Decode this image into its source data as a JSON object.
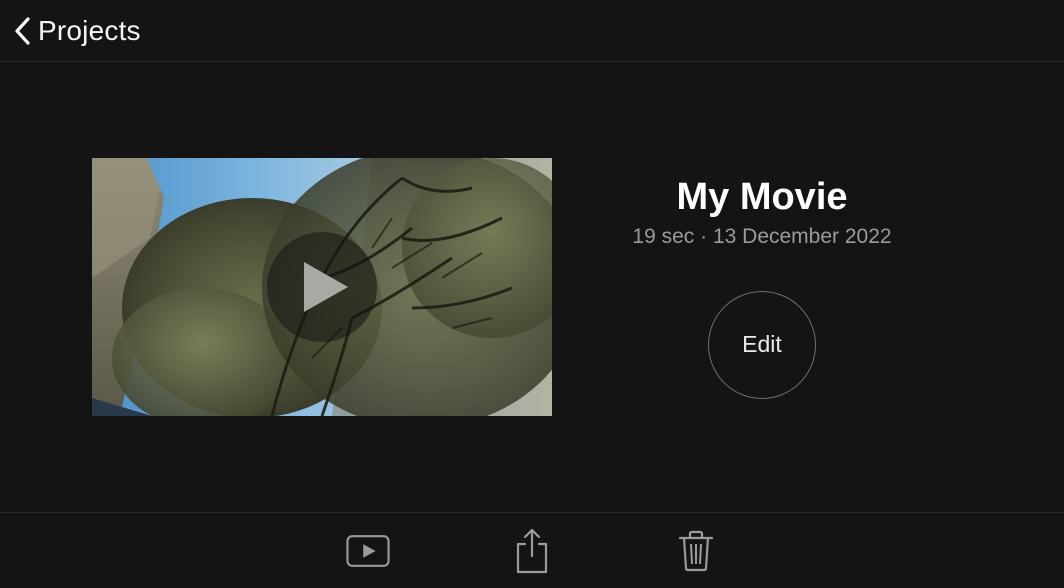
{
  "header": {
    "back_label": "Projects"
  },
  "project": {
    "title": "My Movie",
    "meta": "19 sec · 13 December 2022",
    "edit_label": "Edit"
  },
  "icons": {
    "back": "chevron-left-icon",
    "play": "play-icon",
    "video_play": "play-video-icon",
    "share": "share-icon",
    "delete": "trash-icon"
  }
}
